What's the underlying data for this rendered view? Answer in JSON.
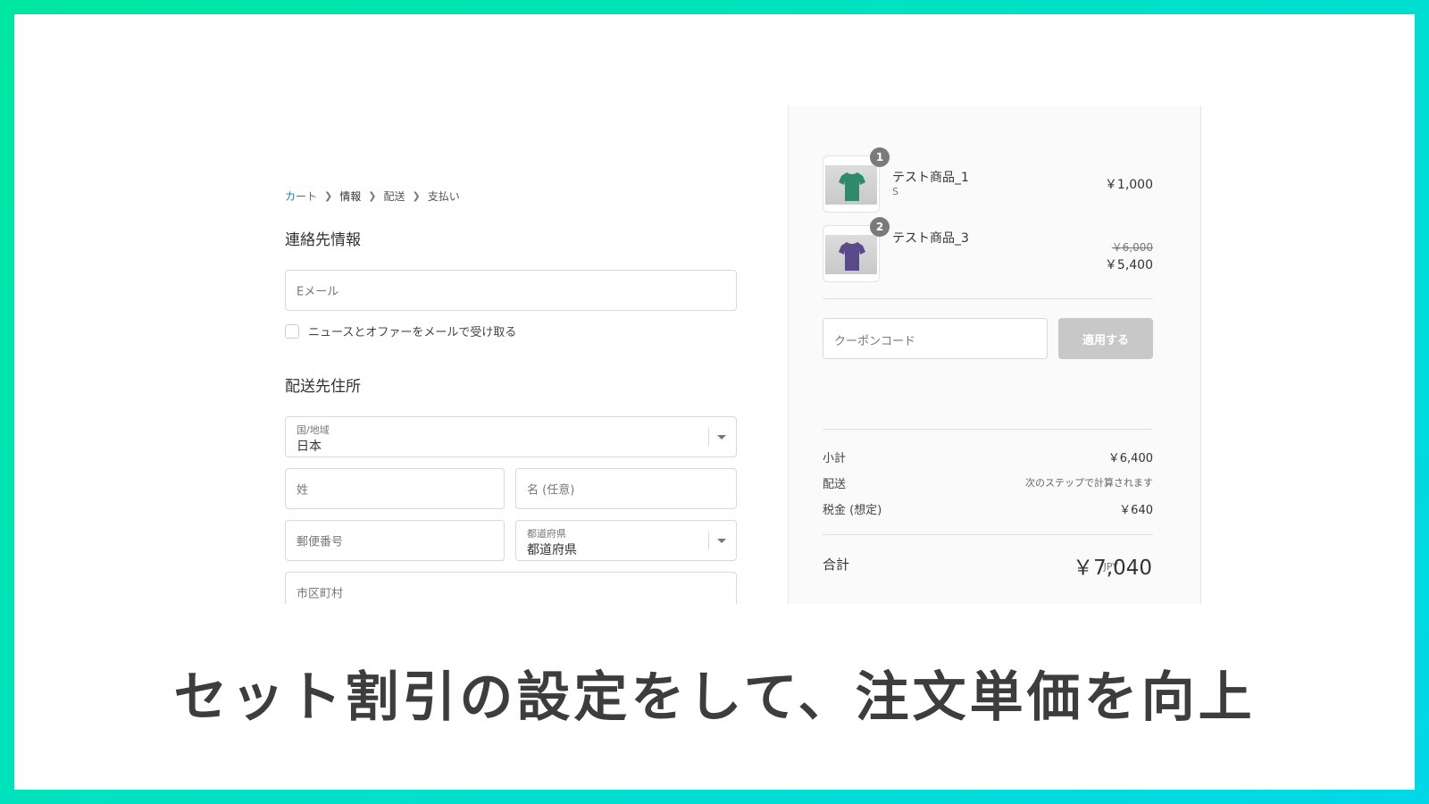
{
  "breadcrumb": [
    "カート",
    "情報",
    "配送",
    "支払い"
  ],
  "contact": {
    "title": "連絡先情報",
    "email_placeholder": "Eメール",
    "newsletter_label": "ニュースとオファーをメールで受け取る"
  },
  "shipping": {
    "title": "配送先住所",
    "country_label": "国/地域",
    "country_value": "日本",
    "last_name_placeholder": "姓",
    "first_name_placeholder": "名 (任意)",
    "postal_placeholder": "郵便番号",
    "prefecture_label": "都道府県",
    "prefecture_value": "都道府県",
    "city_placeholder": "市区町村"
  },
  "summary": {
    "items": [
      {
        "qty": "1",
        "name": "テスト商品_1",
        "variant": "S",
        "price": "￥1,000",
        "old_price": "",
        "color": "#2e8a6a"
      },
      {
        "qty": "2",
        "name": "テスト商品_3",
        "variant": "",
        "price": "￥5,400",
        "old_price": "￥6,000",
        "color": "#5a4a8c"
      }
    ],
    "coupon_placeholder": "クーポンコード",
    "apply_label": "適用する",
    "subtotal_label": "小計",
    "subtotal_value": "￥6,400",
    "shipping_label": "配送",
    "shipping_value": "次のステップで計算されます",
    "tax_label": "税金 (想定)",
    "tax_value": "￥640",
    "total_label": "合計",
    "total_currency": "JPY",
    "total_value": "￥7,040"
  },
  "banner": "セット割引の設定をして、注文単価を向上",
  "colors": {
    "frame_start": "#00e7a0",
    "frame_end": "#00d8e8",
    "link": "#2a7ab0"
  }
}
